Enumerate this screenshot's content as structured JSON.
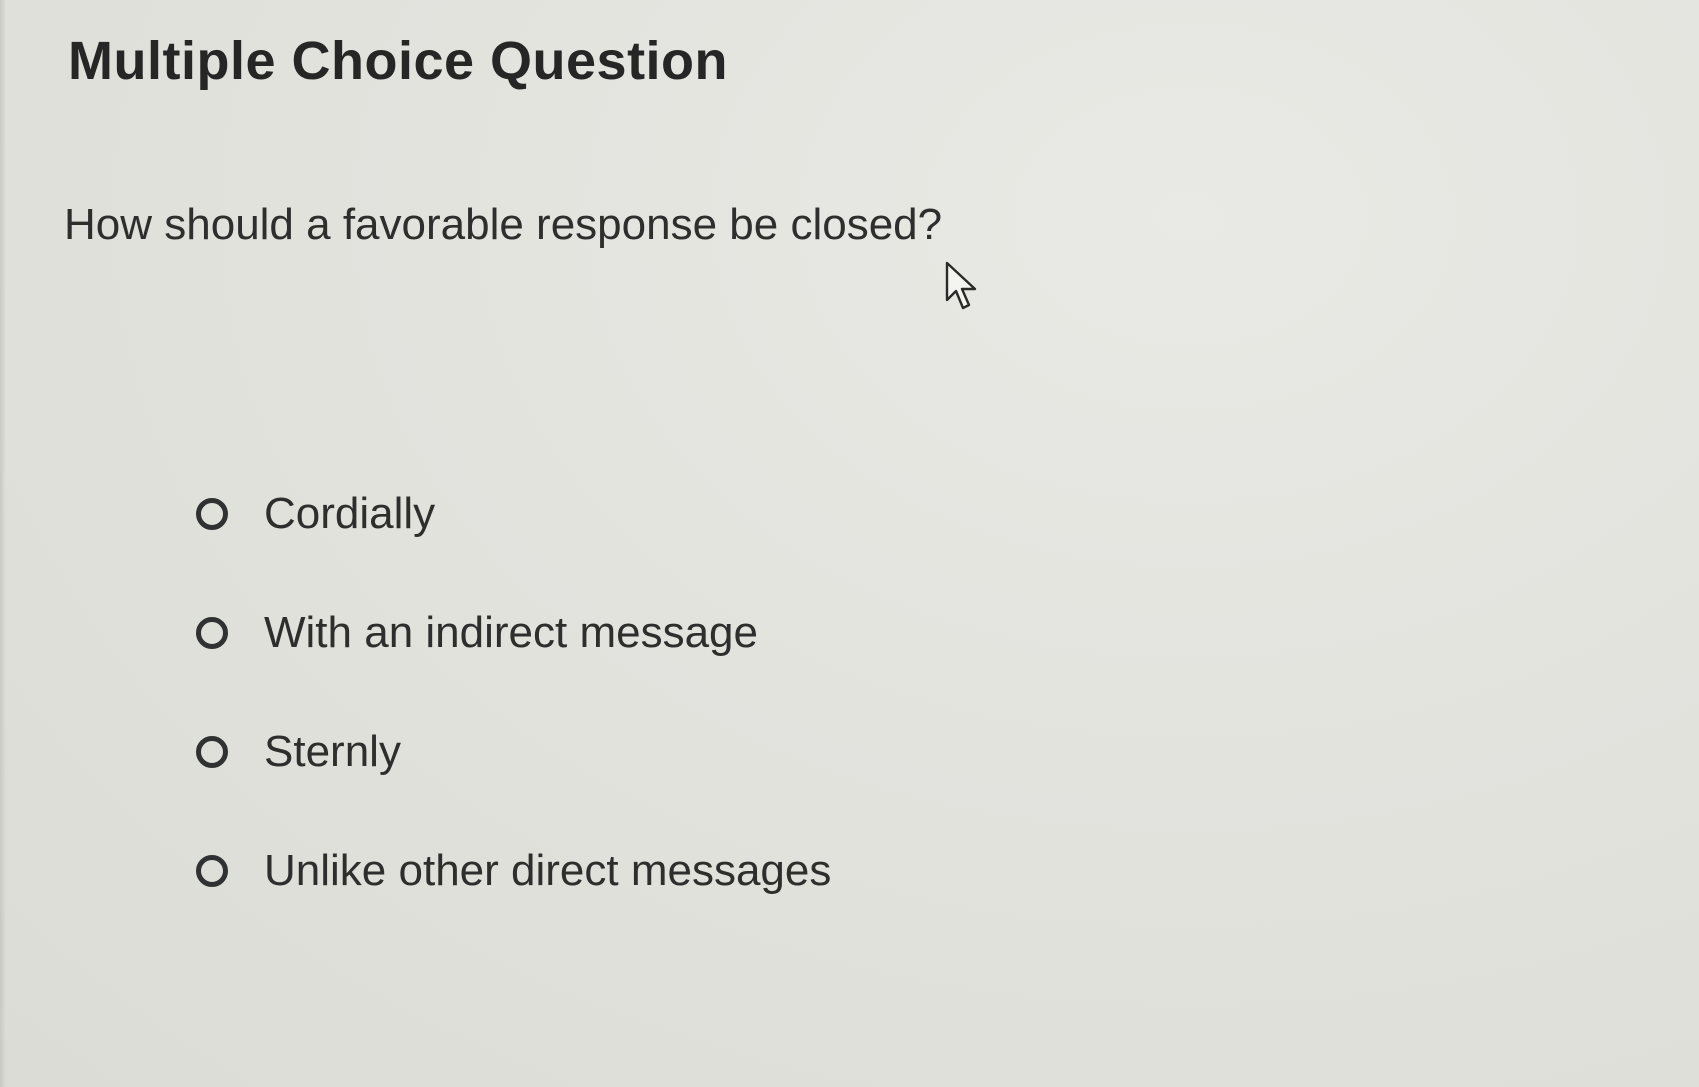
{
  "header": {
    "title": "Multiple Choice Question"
  },
  "question": {
    "text": "How should a favorable response be closed?"
  },
  "options": [
    {
      "label": "Cordially",
      "selected": false
    },
    {
      "label": "With an indirect message",
      "selected": false
    },
    {
      "label": "Sternly",
      "selected": false
    },
    {
      "label": "Unlike other direct messages",
      "selected": false
    }
  ],
  "cursor": {
    "icon": "arrow-pointer-icon"
  }
}
